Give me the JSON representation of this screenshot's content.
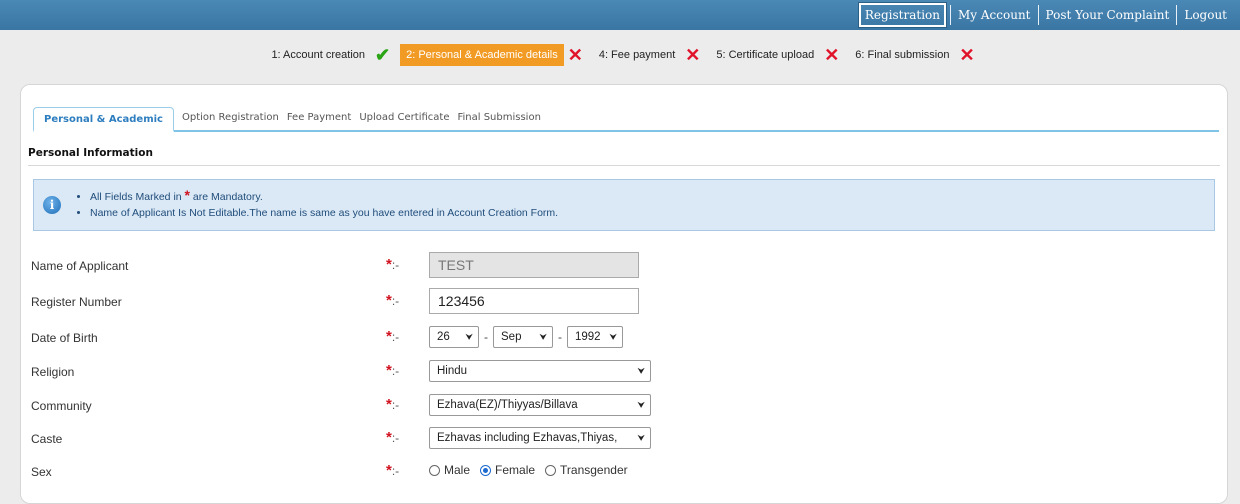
{
  "topnav": [
    "Registration",
    "My Account",
    "Post Your Complaint",
    "Logout"
  ],
  "steps": [
    {
      "label": "1: Account creation",
      "status": "done"
    },
    {
      "label": "2: Personal & Academic details",
      "status": "current"
    },
    {
      "label": "4: Fee payment",
      "status": "pending"
    },
    {
      "label": "5: Certificate upload",
      "status": "pending"
    },
    {
      "label": "6: Final submission",
      "status": "pending"
    }
  ],
  "tabs": [
    "Personal & Academic",
    "Option Registration",
    "Fee Payment",
    "Upload Certificate",
    "Final Submission"
  ],
  "section_title": "Personal Information",
  "info": {
    "line1_prefix": "All Fields Marked in",
    "line1_suffix": "are Mandatory.",
    "line2": "Name of Applicant Is Not Editable.The name is same as you have entered in Account Creation Form."
  },
  "form": {
    "separator": ":-",
    "name": {
      "label": "Name of Applicant",
      "value": "TEST"
    },
    "register": {
      "label": "Register Number",
      "value": "123456"
    },
    "dob": {
      "label": "Date of Birth",
      "day": "26",
      "month": "Sep",
      "year": "1992",
      "dash": "-"
    },
    "religion": {
      "label": "Religion",
      "value": "Hindu"
    },
    "community": {
      "label": "Community",
      "value": "Ezhava(EZ)/Thiyyas/Billava"
    },
    "caste": {
      "label": "Caste",
      "value": "Ezhavas including Ezhavas,Thiyas,"
    },
    "sex": {
      "label": "Sex",
      "options": [
        "Male",
        "Female",
        "Transgender"
      ],
      "selected": "Female"
    }
  },
  "colors": {
    "topbar": "#3a76a4",
    "current_step": "#f29b24",
    "check": "#2aa314",
    "cross": "#e0132a",
    "tab_active": "#2d7dbf",
    "info_bg": "#dbe9f6"
  }
}
